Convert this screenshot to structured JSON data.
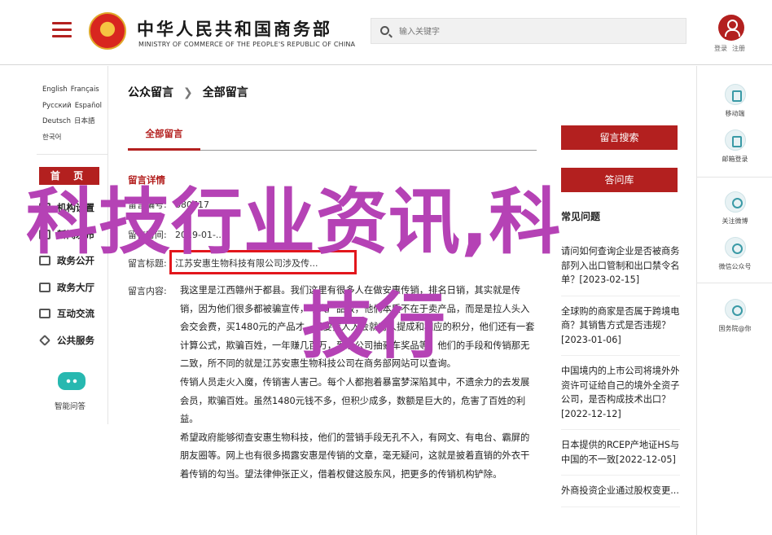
{
  "header": {
    "brand_cn": "中华人民共和国商务部",
    "brand_en": "MINISTRY OF COMMERCE OF THE PEOPLE'S REPUBLIC OF CHINA",
    "search_placeholder": "输入关键字",
    "login": "登录",
    "register": "注册"
  },
  "sidebar": {
    "languages": [
      "English",
      "Français",
      "Русский",
      "Español",
      "Deutsch",
      "日本語",
      "한국어"
    ],
    "home": "首 页",
    "items": [
      {
        "label": "机构设置"
      },
      {
        "label": "新闻发布"
      },
      {
        "label": "政务公开"
      },
      {
        "label": "政务大厅"
      },
      {
        "label": "互动交流"
      },
      {
        "label": "公共服务"
      }
    ],
    "mini_program": "智能问答"
  },
  "breadcrumb": {
    "part1": "公众留言",
    "part2": "全部留言"
  },
  "tab": "全部留言",
  "detail": {
    "title": "留言详情",
    "meta": [
      {
        "key": "留言编号:",
        "value": "680717"
      },
      {
        "key": "留言时间:",
        "value": "2019-01-..."
      },
      {
        "key": "留言标题:",
        "value": "江苏安惠生物科技有限公司涉及传..."
      }
    ],
    "content_label": "留言内容:",
    "paragraphs": [
      "我这里是江西赣州于都县。我们这里有很多人在做安惠传销，排名日销，其实就是传销，因为他们很多都被骗宣传，夸大产品效，他们本质不在于卖产品，而是是拉人头入会交会费，买1480元的产品才，只要拉人入会就有人提成和相应的积分，他们还有一套计算公式，欺骗百姓，一年赚几百万，到总公司抽豪车奖品等。他们的手段和传销那无二致，所不同的就是江苏安惠生物科技公司在商务部网站可以查询。",
      "传销人员走火入魔，传销害人害己。每个人都抱着暴富梦深陷其中，不遗余力的去发展会员，欺骗百姓。虽然1480元钱不多，但积少成多，数额是巨大的，危害了百姓的利益。",
      "希望政府能够彻查安惠生物科技，他们的营销手段无孔不入，有网文、有电台、霸屏的朋友圈等。网上也有很多揭露安惠是传销的文章，毫无疑问，这就是披着直销的外衣干着传销的勾当。望法律伸张正义，借着权健这股东风，把更多的传销机构铲除。"
    ]
  },
  "right": {
    "search_btn": "留言搜索",
    "qa_btn": "答问库",
    "qa_header": "常见问题",
    "qa_items": [
      "请问如何查询企业是否被商务部列入出口管制和出口禁令名单？[2023-02-15]",
      "全球购的商家是否属于跨境电商？其销售方式是否违规？[2023-01-06]",
      "中国境内的上市公司将境外外资许可证给自己的境外全资子公司，是否构成技术出口？[2022-12-12]",
      "日本提供的RCEP产地证HS与中国的不一致[2022-12-05]",
      "外商投资企业通过股权变更..."
    ]
  },
  "rail": [
    {
      "label": "移动端",
      "icon": "phone-icon"
    },
    {
      "label": "邮箱登录",
      "icon": "mail-icon"
    },
    {
      "label": "关注微博",
      "icon": "weibo-icon"
    },
    {
      "label": "微信公众号",
      "icon": "wechat-icon"
    },
    {
      "label": "国务院@你",
      "icon": "at-icon"
    }
  ],
  "overlay": {
    "line1": "科技行业资讯,科",
    "line2": "技行"
  }
}
